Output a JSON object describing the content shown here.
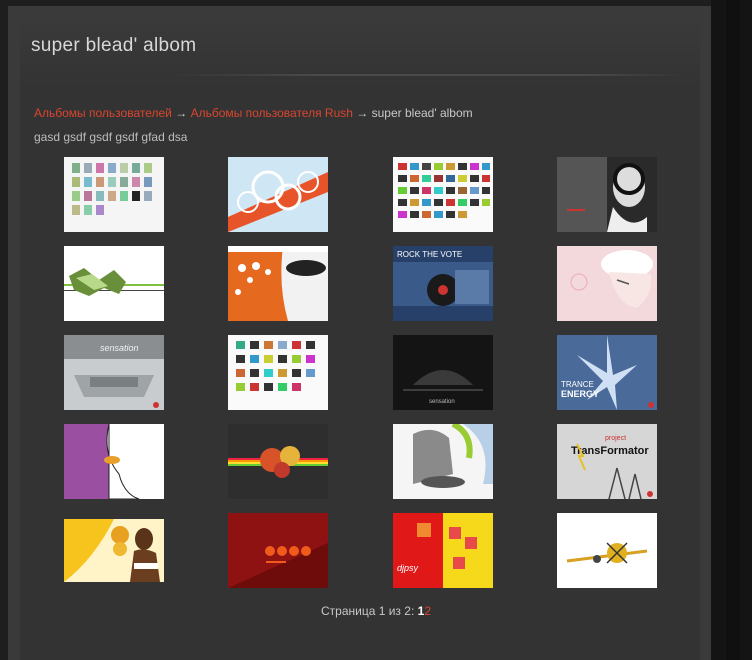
{
  "page": {
    "title": "super blead' albom"
  },
  "breadcrumb": {
    "items": [
      "Альбомы пользователей",
      "Альбомы пользователя Rush"
    ],
    "separator": "→",
    "current": "super blead' albom"
  },
  "album": {
    "description": "gasd gsdf gsdf gsdf gfad dsa"
  },
  "thumbnails": [
    {
      "name": "thumb-collage-white"
    },
    {
      "name": "thumb-orange-swirls"
    },
    {
      "name": "thumb-sticker-grid"
    },
    {
      "name": "thumb-headphones-girl"
    },
    {
      "name": "thumb-green-lines"
    },
    {
      "name": "thumb-orange-face"
    },
    {
      "name": "thumb-rock-the-vote"
    },
    {
      "name": "thumb-pink-girl"
    },
    {
      "name": "thumb-sensation-grey"
    },
    {
      "name": "thumb-sticker-grid-2"
    },
    {
      "name": "thumb-sensation-dark"
    },
    {
      "name": "thumb-trance-energy"
    },
    {
      "name": "thumb-purple-face"
    },
    {
      "name": "thumb-rainbow-dark"
    },
    {
      "name": "thumb-dj-grey"
    },
    {
      "name": "thumb-transformator"
    },
    {
      "name": "thumb-yellow-woman"
    },
    {
      "name": "thumb-red-circles"
    },
    {
      "name": "thumb-red-yellow-dj"
    },
    {
      "name": "thumb-white-splash"
    }
  ],
  "thumb_texts": {
    "rock_the_vote": "ROCK THE VOTE",
    "sensation": "sensation",
    "trance": "TRANCE",
    "energy": "ENERGY",
    "project": "project",
    "transformator": "TransFormator",
    "djpsy": "djpsy"
  },
  "pager": {
    "label": "Страница 1 из 2:",
    "current": "1",
    "next": "2"
  },
  "colors": {
    "link": "#d9462f",
    "background": "#333333"
  }
}
